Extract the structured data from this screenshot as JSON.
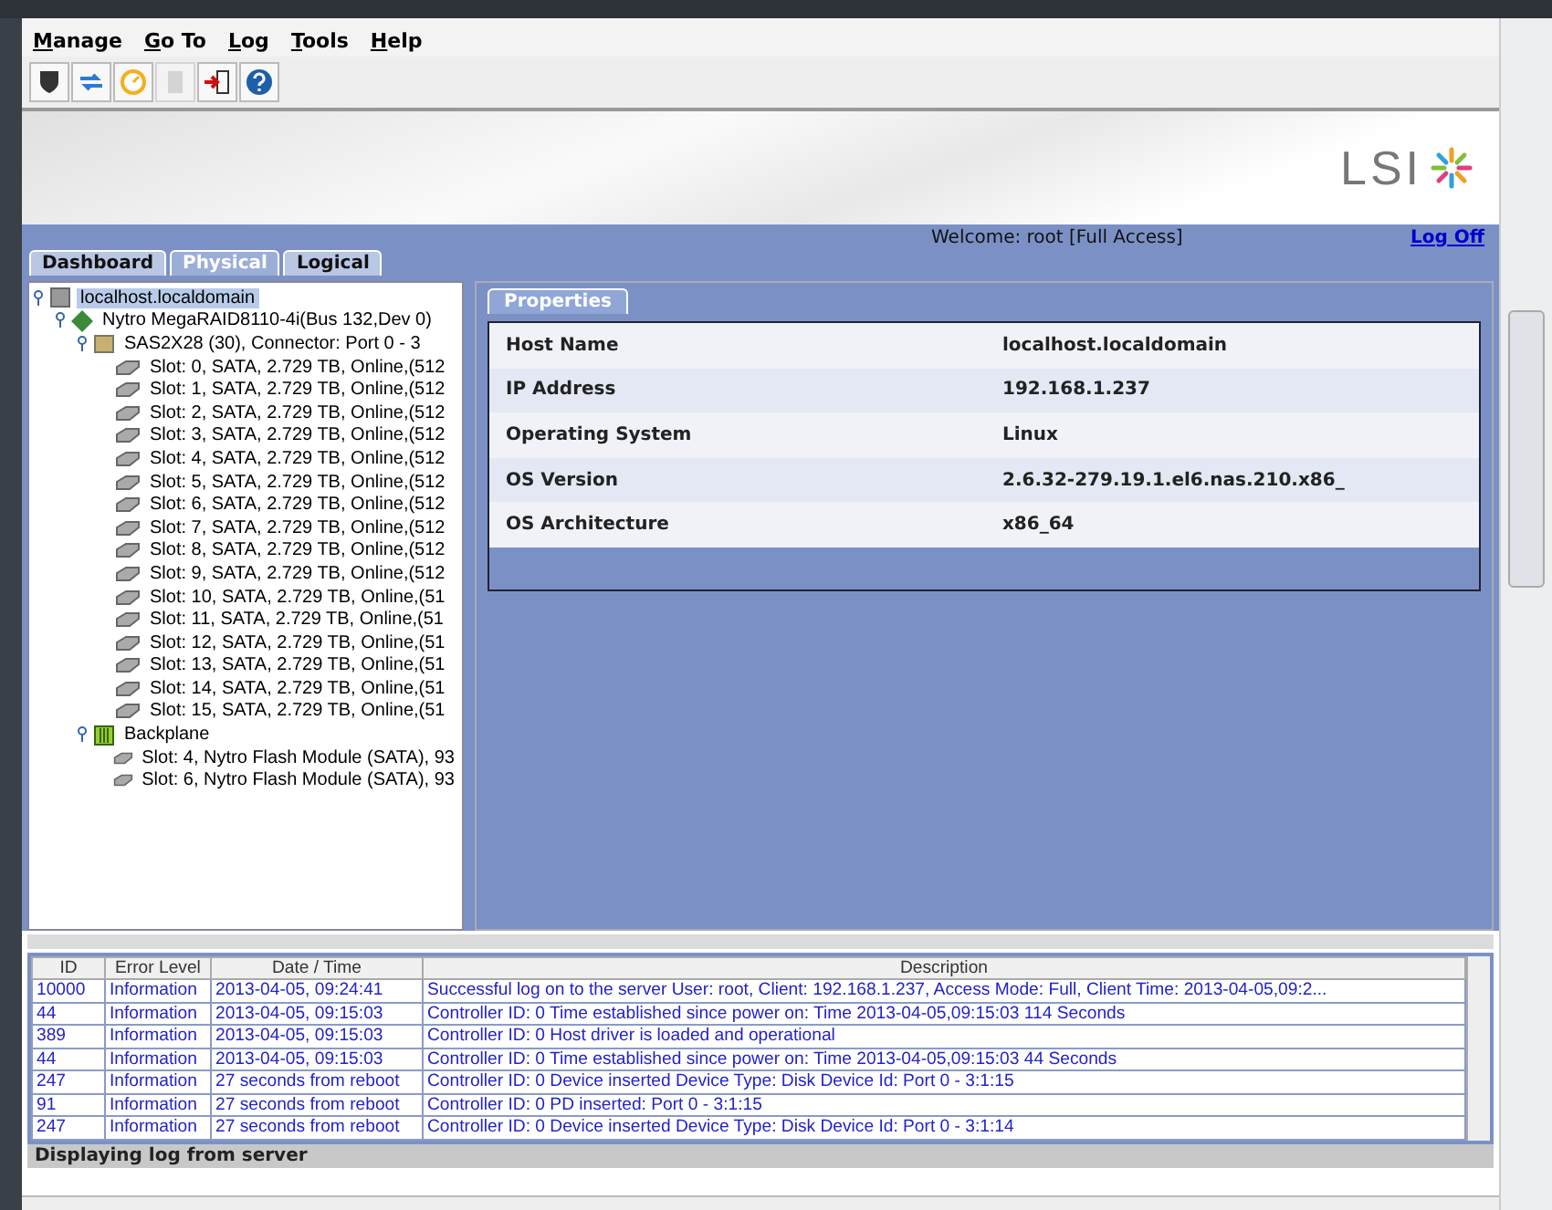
{
  "menu": [
    {
      "label": "Manage"
    },
    {
      "label": "Go To"
    },
    {
      "label": "Log"
    },
    {
      "label": "Tools"
    },
    {
      "label": "Help"
    }
  ],
  "toolbar": [
    {
      "kind": "shield",
      "disabled": false
    },
    {
      "kind": "refresh",
      "disabled": false
    },
    {
      "kind": "clock",
      "disabled": false
    },
    {
      "kind": "doc",
      "disabled": true
    },
    {
      "kind": "exit",
      "disabled": false
    },
    {
      "kind": "help",
      "disabled": false
    }
  ],
  "logo_text": "LSI",
  "welcome": "Welcome: root [Full Access]",
  "log_off": "Log Off",
  "tabs": [
    {
      "label": "Dashboard",
      "selected": false
    },
    {
      "label": "Physical",
      "selected": true
    },
    {
      "label": "Logical",
      "selected": false
    }
  ],
  "tree": [
    {
      "kind": "server",
      "label": "localhost.localdomain",
      "selected": true,
      "expanded": true,
      "children": [
        {
          "kind": "controller",
          "label": "Nytro MegaRAID8110-4i(Bus 132,Dev 0)",
          "selected": false,
          "expanded": true,
          "children": [
            {
              "kind": "enclosure",
              "label": "SAS2X28 (30), Connector: Port 0 - 3",
              "selected": false,
              "expanded": true,
              "children": [
                {
                  "kind": "disk",
                  "label": "Slot: 0, SATA, 2.729 TB, Online,(512",
                  "selected": false
                },
                {
                  "kind": "disk",
                  "label": "Slot: 1, SATA, 2.729 TB, Online,(512",
                  "selected": false
                },
                {
                  "kind": "disk",
                  "label": "Slot: 2, SATA, 2.729 TB, Online,(512",
                  "selected": false
                },
                {
                  "kind": "disk",
                  "label": "Slot: 3, SATA, 2.729 TB, Online,(512",
                  "selected": false
                },
                {
                  "kind": "disk",
                  "label": "Slot: 4, SATA, 2.729 TB, Online,(512",
                  "selected": false
                },
                {
                  "kind": "disk",
                  "label": "Slot: 5, SATA, 2.729 TB, Online,(512",
                  "selected": false
                },
                {
                  "kind": "disk",
                  "label": "Slot: 6, SATA, 2.729 TB, Online,(512",
                  "selected": false
                },
                {
                  "kind": "disk",
                  "label": "Slot: 7, SATA, 2.729 TB, Online,(512",
                  "selected": false
                },
                {
                  "kind": "disk",
                  "label": "Slot: 8, SATA, 2.729 TB, Online,(512",
                  "selected": false
                },
                {
                  "kind": "disk",
                  "label": "Slot: 9, SATA, 2.729 TB, Online,(512",
                  "selected": false
                },
                {
                  "kind": "disk",
                  "label": "Slot: 10, SATA, 2.729 TB, Online,(51",
                  "selected": false
                },
                {
                  "kind": "disk",
                  "label": "Slot: 11, SATA, 2.729 TB, Online,(51",
                  "selected": false
                },
                {
                  "kind": "disk",
                  "label": "Slot: 12, SATA, 2.729 TB, Online,(51",
                  "selected": false
                },
                {
                  "kind": "disk",
                  "label": "Slot: 13, SATA, 2.729 TB, Online,(51",
                  "selected": false
                },
                {
                  "kind": "disk",
                  "label": "Slot: 14, SATA, 2.729 TB, Online,(51",
                  "selected": false
                },
                {
                  "kind": "disk",
                  "label": "Slot: 15, SATA, 2.729 TB, Online,(51",
                  "selected": false
                }
              ]
            },
            {
              "kind": "backplane",
              "label": "Backplane",
              "selected": false,
              "expanded": true,
              "children": [
                {
                  "kind": "disk",
                  "label": "Slot: 4, Nytro Flash Module (SATA), 93",
                  "selected": false
                },
                {
                  "kind": "disk",
                  "label": "Slot: 6, Nytro Flash Module (SATA), 93",
                  "selected": false
                }
              ]
            }
          ]
        }
      ]
    }
  ],
  "properties_tab": "Properties",
  "properties": [
    {
      "name": "Host Name",
      "value": "localhost.localdomain"
    },
    {
      "name": "IP Address",
      "value": "192.168.1.237"
    },
    {
      "name": "Operating System",
      "value": "Linux"
    },
    {
      "name": "OS Version",
      "value": "2.6.32-279.19.1.el6.nas.210.x86_"
    },
    {
      "name": "OS Architecture",
      "value": "x86_64"
    }
  ],
  "log": {
    "columns": [
      "ID",
      "Error Level",
      "Date / Time",
      "Description"
    ],
    "rows": [
      [
        "10000",
        "Information",
        "2013-04-05, 09:24:41",
        "Successful log on to the server User: root, Client: 192.168.1.237, Access Mode: Full, Client Time: 2013-04-05,09:2..."
      ],
      [
        "44",
        "Information",
        "2013-04-05, 09:15:03",
        "Controller ID: 0 Time established since power on: Time 2013-04-05,09:15:03 114 Seconds"
      ],
      [
        "389",
        "Information",
        "2013-04-05, 09:15:03",
        "Controller ID: 0 Host driver is loaded and operational"
      ],
      [
        "44",
        "Information",
        "2013-04-05, 09:15:03",
        "Controller ID: 0 Time established since power on: Time 2013-04-05,09:15:03 44 Seconds"
      ],
      [
        "247",
        "Information",
        "27 seconds from reboot",
        "Controller ID: 0 Device inserted Device Type: Disk Device Id: Port 0 - 3:1:15"
      ],
      [
        "91",
        "Information",
        "27 seconds from reboot",
        "Controller ID: 0 PD inserted: Port 0 - 3:1:15"
      ],
      [
        "247",
        "Information",
        "27 seconds from reboot",
        "Controller ID: 0 Device inserted Device Type: Disk Device Id: Port 0 - 3:1:14"
      ]
    ]
  },
  "status": "Displaying log from server"
}
